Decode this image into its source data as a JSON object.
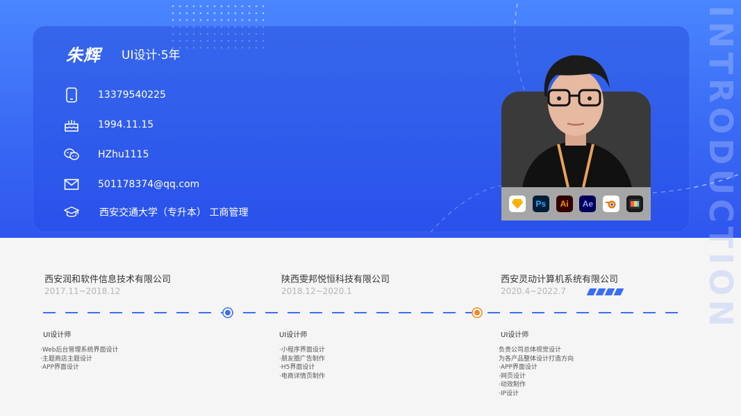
{
  "profile": {
    "name": "朱辉",
    "role": "UI设计·5年",
    "phone": "13379540225",
    "birthday": "1994.11.15",
    "wechat": "HZhu1115",
    "email": "501178374@qq.com",
    "education": "西安交通大学（专升本） 工商管理"
  },
  "side_word": "INTRODUCTION",
  "tools": [
    {
      "name": "sketch-icon",
      "label": "",
      "bg": "#ffffff",
      "fg": "#f7b500"
    },
    {
      "name": "photoshop-icon",
      "label": "Ps",
      "bg": "#001e36",
      "fg": "#31a8ff"
    },
    {
      "name": "illustrator-icon",
      "label": "Ai",
      "bg": "#330000",
      "fg": "#ff9a00"
    },
    {
      "name": "after-effects-icon",
      "label": "Ae",
      "bg": "#00005b",
      "fg": "#9999ff"
    },
    {
      "name": "blender-icon",
      "label": "",
      "bg": "#ffffff",
      "fg": "#ea7600"
    },
    {
      "name": "final-cut-icon",
      "label": "",
      "bg": "#1a1a1a",
      "fg": "#ffffff"
    }
  ],
  "experience": [
    {
      "company": "西安润和软件信息技术有限公司",
      "period": "2017.11~2018.12",
      "title": "UI设计师",
      "duties": [
        "·Web后台管理系统界面设计",
        "·主题商店主题设计",
        "·APP界面设计"
      ]
    },
    {
      "company": "陕西雯邦悦恒科技有限公司",
      "period": "2018.12~2020.1",
      "title": "UI设计师",
      "duties": [
        "·小程序界面设计",
        "·朋友圈广告制作",
        "·H5界面设计",
        "·电商详情页制作"
      ]
    },
    {
      "company": "西安灵动计算机系统有限公司",
      "period": "2020.4~2022.7",
      "title": "UI设计师",
      "duties": [
        "负责公司总体视觉设计",
        "为各产品整体设计打造方向",
        "·APP界面设计",
        "·网页设计",
        "·动效制作",
        "·IP设计"
      ]
    }
  ],
  "colors": {
    "accent": "#3b6cf5",
    "marker_active": "#f08a24"
  }
}
